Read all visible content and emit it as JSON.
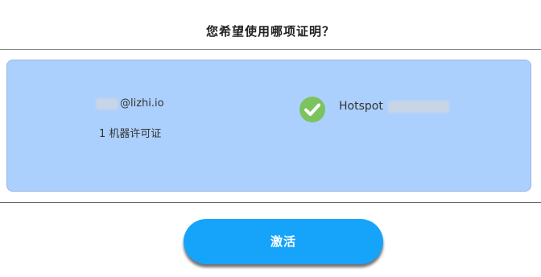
{
  "dialog": {
    "title": "您希望使用哪项证明？"
  },
  "license": {
    "email": "@lizhi.io",
    "license_count": "1 机器许可证",
    "host_label": "Hotspot",
    "selected": true,
    "check_icon": "check-circle-icon",
    "check_color": "#7cc35d",
    "card_color": "#acd0fd"
  },
  "actions": {
    "activate_label": "激活",
    "button_color": "#16a4fb"
  }
}
